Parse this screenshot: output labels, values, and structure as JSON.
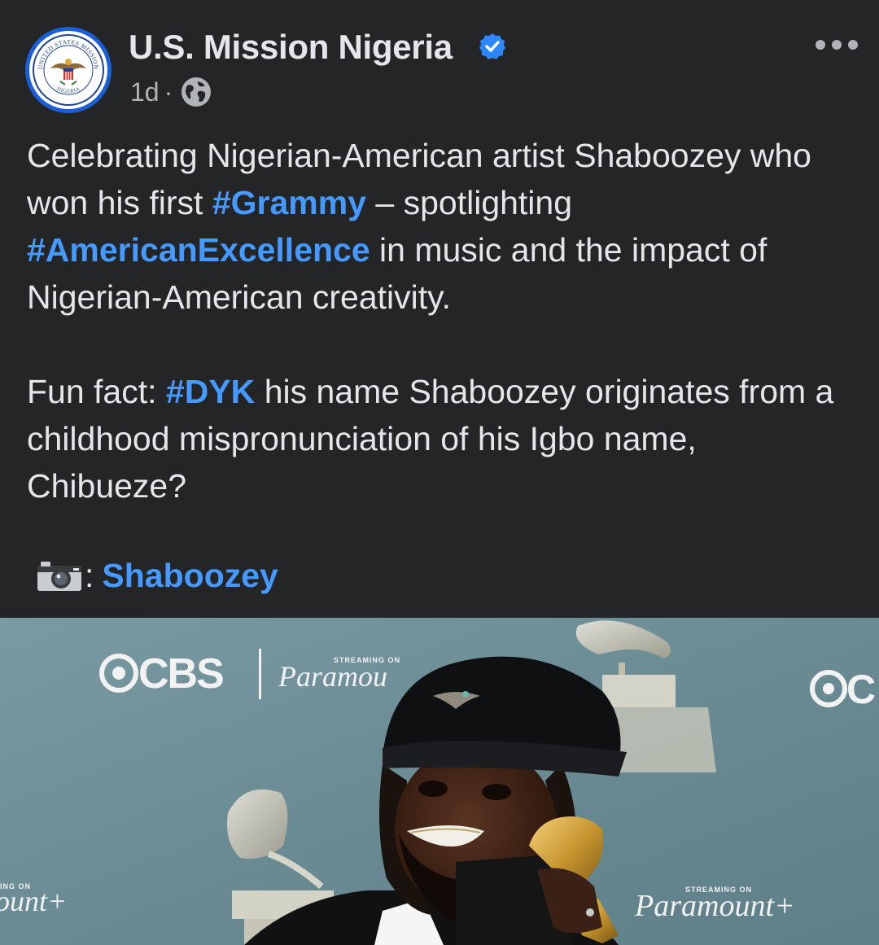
{
  "post": {
    "author": "U.S. Mission Nigeria",
    "time": "1d",
    "separator": "·",
    "text": {
      "p1": {
        "a": "Celebrating Nigerian-American artist Shaboozey who won his first ",
        "tag1": "#Grammy",
        "b": " – spotlighting ",
        "tag2": "#AmericanExcellence",
        "c": " in music and the impact of Nigerian-American creativity."
      },
      "p2": {
        "a": "Fun fact: ",
        "tag1": "#DYK",
        "b": " his name Shaboozey originates from a childhood mispronunciation of his Igbo name, Chibueze?"
      },
      "credit": {
        "colon": ":",
        "link": "Shaboozey"
      }
    }
  },
  "avatar": {
    "seal_top": "UNITED STATES MISSION",
    "seal_bottom": "NIGERIA"
  },
  "photo": {
    "backdrop_logos": {
      "cbs": "CBS",
      "cbs_right": "C",
      "streaming_on": "STREAMING ON",
      "paramount_left": "Paramou",
      "paramount_right": "Paramount+",
      "streaming_left": "ING ON",
      "paramount_far_left": "ount+"
    }
  },
  "colors": {
    "background": "#242526",
    "text": "#e4e6eb",
    "muted": "#b0b3b8",
    "hashtag": "#4599ff",
    "verified": "#2d88ff",
    "backdrop": "#6e8f98"
  },
  "icons": [
    "verified-badge-icon",
    "globe-icon",
    "more-options-icon",
    "camera-icon"
  ]
}
